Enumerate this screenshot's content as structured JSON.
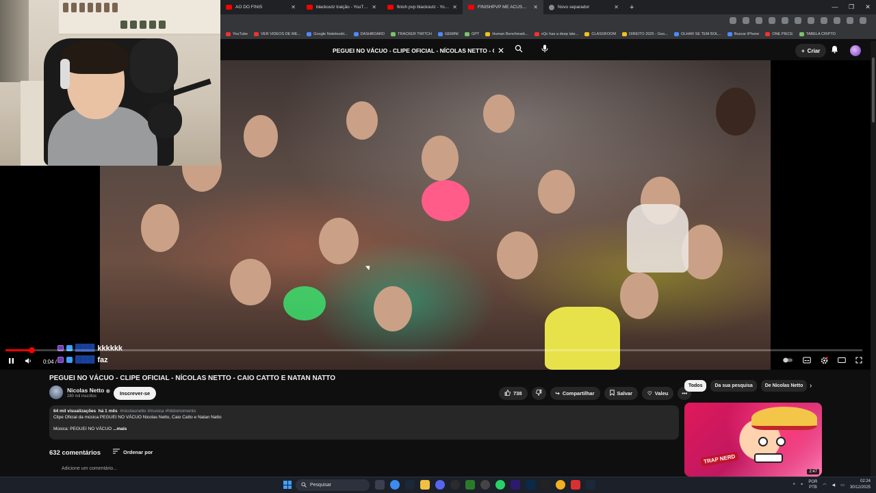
{
  "browser": {
    "tabs": [
      {
        "title": "ÃO DO FINIS",
        "favicon": "youtube-icon",
        "active": false
      },
      {
        "title": "blackoutz traição - YouTube",
        "favicon": "youtube-icon",
        "active": false
      },
      {
        "title": "finish pvp blackoutz - YouTube",
        "favicon": "youtube-icon",
        "active": false
      },
      {
        "title": "FINISHPVP ME ACUSOU DE HA",
        "favicon": "youtube-icon",
        "active": true
      },
      {
        "title": "Novo separador",
        "favicon": "globe-icon",
        "active": false
      }
    ],
    "bookmarks": [
      "YouTube",
      "VER VIDEOS DE ME...",
      "Google Notebookl...",
      "DASHBOARD",
      "TRACKER TWITCH",
      "GEMINI",
      "GPT",
      "Human Benchmark...",
      "xQc has a deep late...",
      "CLASSROOM",
      "DIREITO 2025 - Goo...",
      "OLHAR SE TEM BOL...",
      "Buscar iPhone",
      "ONE PIECE",
      "TABELA CRIPTO"
    ]
  },
  "youtube": {
    "search_query": "PEGUEI NO VÁCUO - CLIPE OFICIAL - NÍCOLAS NETTO - CAIO CA",
    "create_label": "Criar",
    "video": {
      "title": "PEGUEI NO VÁCUO - CLIPE OFICIAL - NÍCOLAS NETTO - CAIO CATTO E NATAN NATTO",
      "current_time": "0:04 /",
      "progress": 0.03,
      "channel_name": "Nicolas Netto",
      "channel_subs": "280 mil inscritos",
      "subscribe_label": "Inscrever-se",
      "likes": "738",
      "share_label": "Compartilhar",
      "save_label": "Salvar",
      "thanks_label": "Valeu",
      "views": "64 mil visualizações",
      "age": "há 1 mês",
      "hashtags": "#nicolasnetto #musica #hitdomomento",
      "desc_line1": "Clipe Oficial da música PEGUEI NO VÁCUO Nicolas Netto, Caio Catto e Natan Natto",
      "desc_line2": "Música: PEGUEI NO VÁCUO",
      "more_label": "...mais"
    },
    "comments": {
      "count": "632 comentários",
      "sort_label": "Ordenar por",
      "add_placeholder": "Adicione um comentário..."
    },
    "chips": [
      "Todos",
      "Da sua pesquisa",
      "De Nicolas Netto"
    ],
    "next_video": {
      "brand": "TRAP NERD",
      "duration": "2:47"
    }
  },
  "chat_overlay": [
    {
      "message": "kkkkkk"
    },
    {
      "message": "faz"
    }
  ],
  "taskbar": {
    "search_label": "Pesquisar",
    "lang_top": "POR",
    "lang_bottom": "PTB",
    "time": "02:24",
    "date": "30/12/2025"
  },
  "colors": {
    "youtube_red": "#ff0000",
    "background": "#0f0f0f",
    "pill": "#272727"
  }
}
